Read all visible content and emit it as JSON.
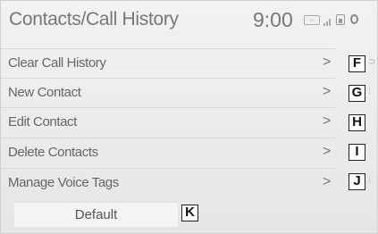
{
  "header": {
    "title": "Contacts/Call History",
    "time": "9:00",
    "status_icons": [
      "bluetooth-badge-icon",
      "signal-bars-icon",
      "phone-battery-icon",
      "ring-icon"
    ]
  },
  "menu": {
    "items": [
      {
        "label": "Clear Call History",
        "callout": "F"
      },
      {
        "label": "New Contact",
        "callout": "G"
      },
      {
        "label": "Edit Contact",
        "callout": "H"
      },
      {
        "label": "Delete Contacts",
        "callout": "I"
      },
      {
        "label": "Manage Voice Tags",
        "callout": "J"
      }
    ],
    "chevron": ">"
  },
  "default_button": {
    "label": "Default",
    "callout": "K"
  }
}
